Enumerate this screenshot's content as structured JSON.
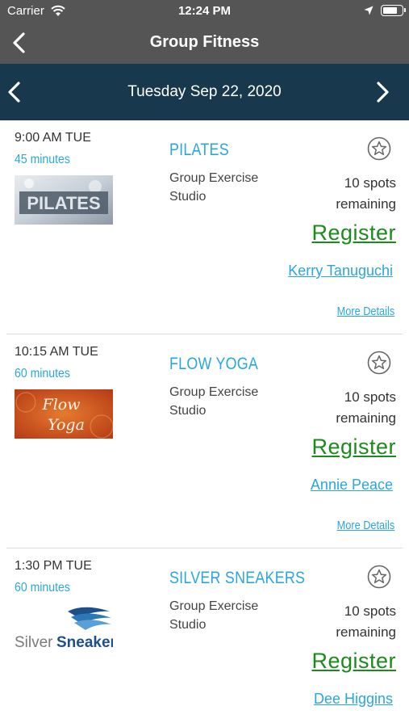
{
  "status_bar": {
    "carrier": "Carrier",
    "time": "12:24 PM",
    "icons": [
      "wifi-icon",
      "location-arrow-icon",
      "battery-icon"
    ]
  },
  "nav": {
    "title": "Group Fitness",
    "back_icon": "chevron-left-icon"
  },
  "date_bar": {
    "date": "Tuesday Sep 22, 2020",
    "prev_icon": "chevron-left-icon",
    "next_icon": "chevron-right-icon"
  },
  "colors": {
    "header_gray": "#555555",
    "date_bar_navy": "#17384d",
    "accent_blue": "#2aa6df",
    "register_green": "#1c8a1c"
  },
  "classes": [
    {
      "time": "9:00 AM TUE",
      "duration": "45 minutes",
      "name": "PILATES",
      "location": "Group Exercise Studio",
      "spots": "10 spots remaining",
      "register": "Register",
      "instructor": "Kerry Tanuguchi",
      "details": "More Details",
      "image_text": "PILATES"
    },
    {
      "time": "10:15 AM TUE",
      "duration": "60 minutes",
      "name": "FLOW YOGA",
      "location": "Group Exercise Studio",
      "spots": "10 spots remaining",
      "register": "Register",
      "instructor": "Annie Peace",
      "details": "More Details",
      "image_text_1": "Flow",
      "image_text_2": "Yoga"
    },
    {
      "time": "1:30 PM TUE",
      "duration": "60 minutes",
      "name": "SILVER SNEAKERS",
      "location": "Group Exercise Studio",
      "spots": "10 spots remaining",
      "register": "Register",
      "instructor": "Dee Higgins",
      "image_text_1": "Silver",
      "image_text_2": "Sneakers"
    }
  ]
}
